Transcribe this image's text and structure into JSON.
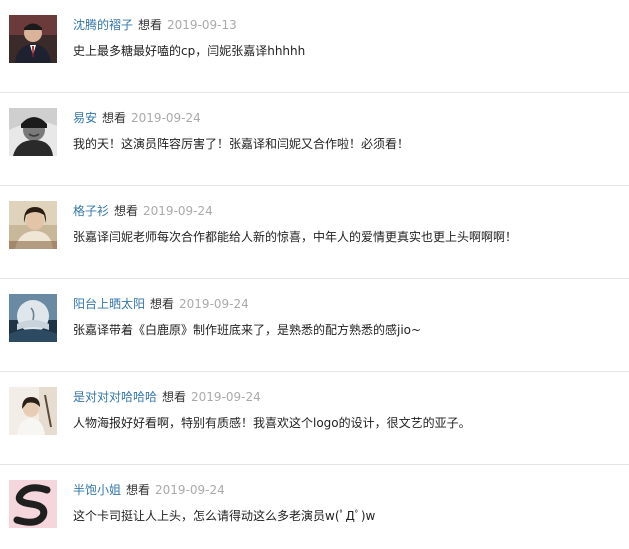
{
  "comments": [
    {
      "user": "沈腾的褶子",
      "status": "想看",
      "date": "2019-09-13",
      "text": "史上最多糖最好嗑的cp，闫妮张嘉译hhhhh",
      "avatar_icon": "user-avatar-icon"
    },
    {
      "user": "易安",
      "status": "想看",
      "date": "2019-09-24",
      "text": "我的天！这演员阵容厉害了！张嘉译和闫妮又合作啦！必须看！",
      "avatar_icon": "user-avatar-icon"
    },
    {
      "user": "格子衫",
      "status": "想看",
      "date": "2019-09-24",
      "text": "张嘉译闫妮老师每次合作都能给人新的惊喜，中年人的爱情更真实也更上头啊啊啊！",
      "avatar_icon": "user-avatar-icon"
    },
    {
      "user": "阳台上晒太阳",
      "status": "想看",
      "date": "2019-09-24",
      "text": "张嘉译带着《白鹿原》制作班底来了，是熟悉的配方熟悉的感jio~",
      "avatar_icon": "user-avatar-icon"
    },
    {
      "user": "是对对对哈哈哈",
      "status": "想看",
      "date": "2019-09-24",
      "text": "人物海报好好看啊，特别有质感！我喜欢这个logo的设计，很文艺的亚子。",
      "avatar_icon": "user-avatar-icon"
    },
    {
      "user": "半饱小姐",
      "status": "想看",
      "date": "2019-09-24",
      "text": "这个卡司挺让人上头，怎么请得动这么多老演员w(ﾟДﾟ)w",
      "avatar_icon": "user-avatar-icon"
    }
  ]
}
